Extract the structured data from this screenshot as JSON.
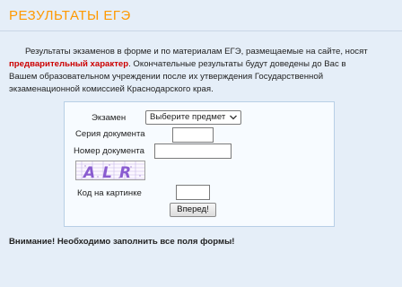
{
  "header": {
    "title": "РЕЗУЛЬТАТЫ ЕГЭ"
  },
  "intro": {
    "part1": "Результаты экзаменов в форме и по материалам ЕГЭ, размещаемые на сайте, носят ",
    "highlight": "предварительный характер",
    "part2": ". Окончательные результаты будут доведены до Вас в Вашем образовательном учреждении после их утверждения Государственной экзаменационной комиссией Краснодарского края."
  },
  "form": {
    "exam_label": "Экзамен",
    "exam_selected": "Выберите предмет",
    "series_label": "Серия документа",
    "series_value": "",
    "number_label": "Номер документа",
    "number_value": "",
    "captcha_text": "ALR",
    "captcha_label": "Код на картинке",
    "captcha_value": "",
    "submit_label": "Вперед!"
  },
  "warning": "Внимание! Необходимо заполнить все поля формы!",
  "colors": {
    "title": "#ff9900",
    "highlight": "#cc0000",
    "background": "#e5eef8",
    "form_background": "#f7fbff"
  }
}
